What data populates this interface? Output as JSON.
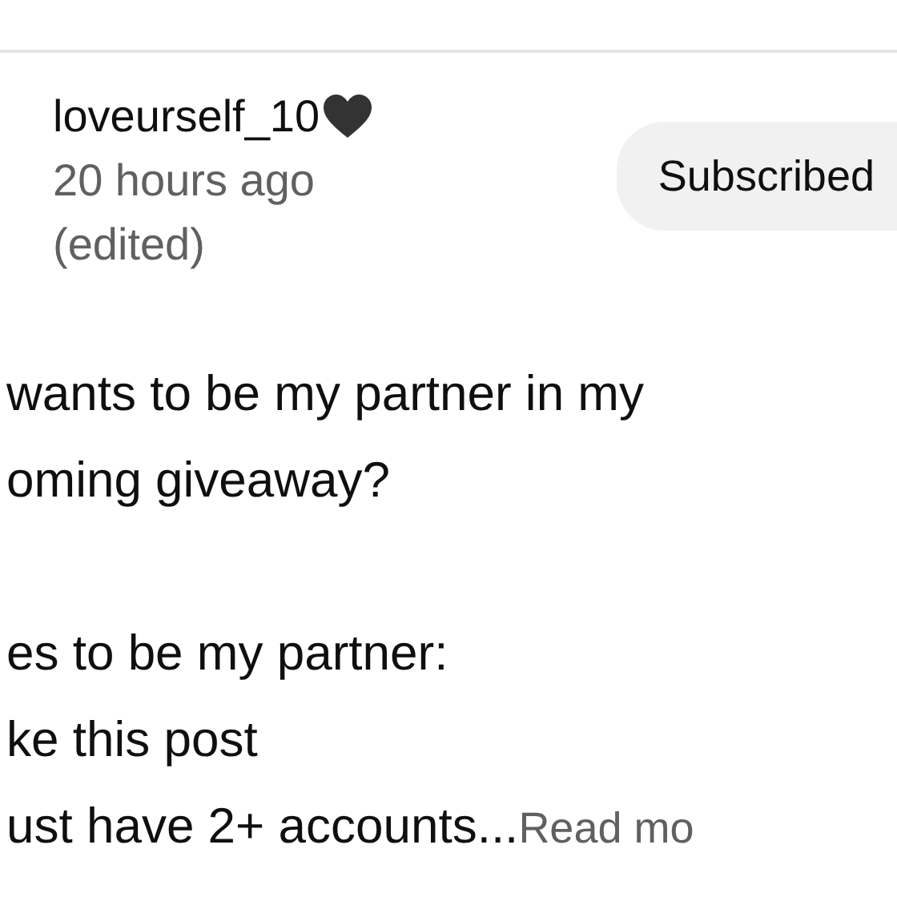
{
  "post": {
    "author": "loveurself_10",
    "time": "20 hours ago",
    "edited": "(edited)",
    "subscribe_button": {
      "label": "Subscribed",
      "subscribed": true
    },
    "paragraphs": [
      [
        "wants to be my partner in my",
        "oming giveaway?"
      ],
      [
        "es to be my partner:",
        "ke this post",
        "ust have 2+ accounts..."
      ]
    ],
    "read_more": "Read mo"
  }
}
